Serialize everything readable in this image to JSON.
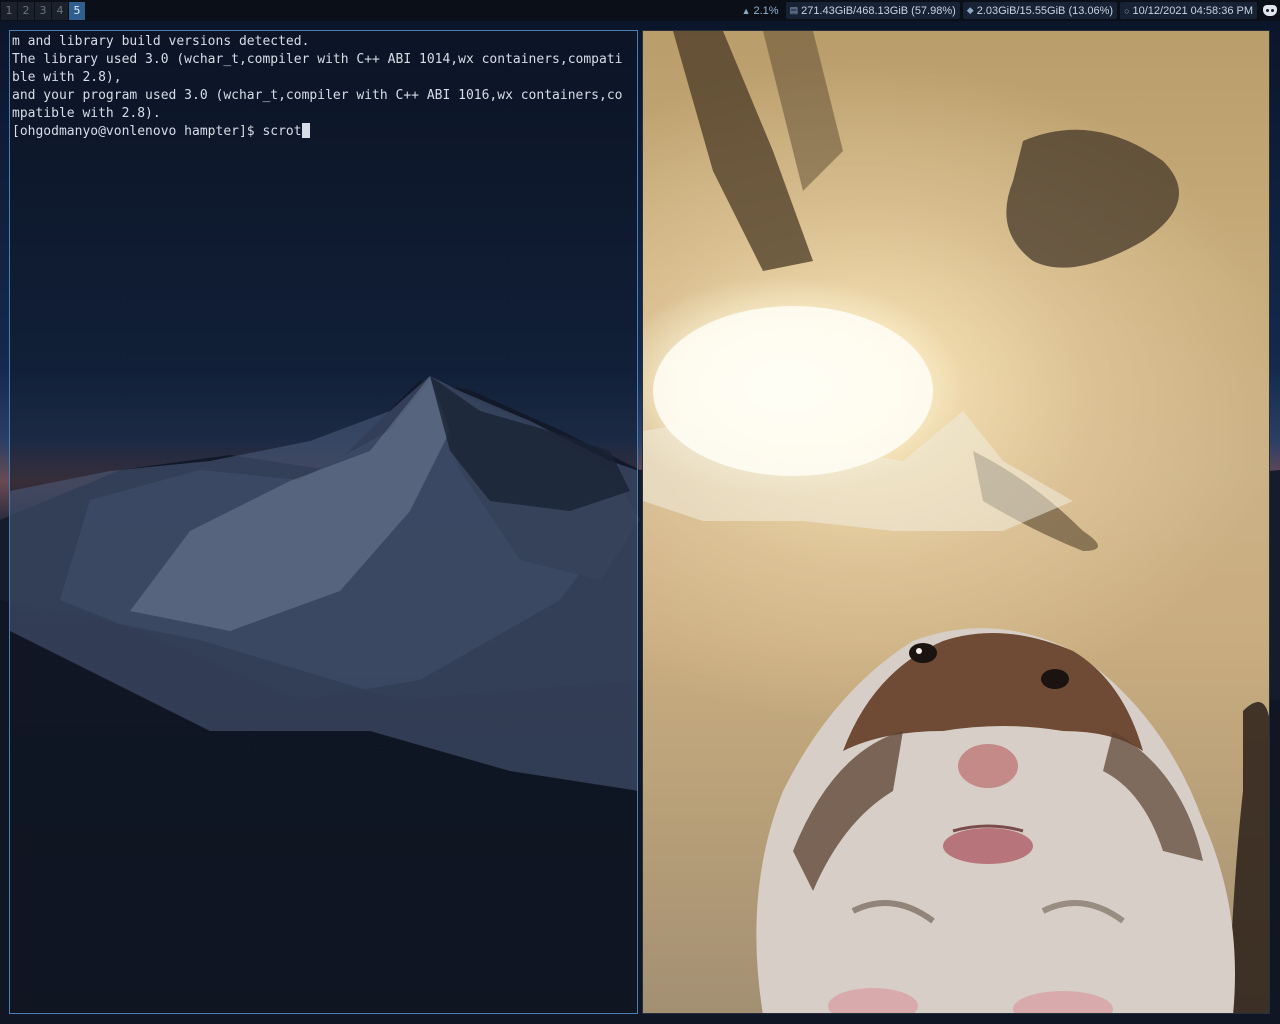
{
  "topbar": {
    "workspaces": [
      {
        "label": "1",
        "active": false
      },
      {
        "label": "2",
        "active": false
      },
      {
        "label": "3",
        "active": false
      },
      {
        "label": "4",
        "active": false
      },
      {
        "label": "5",
        "active": true
      }
    ],
    "status": {
      "cpu": "2.1%",
      "disk": "271.43GiB/468.13GiB (57.98%)",
      "memory": "2.03GiB/15.55GiB (13.06%)",
      "datetime": "10/12/2021 04:58:36 PM"
    },
    "tray_icon": "discord-icon"
  },
  "terminal": {
    "lines": [
      "m and library build versions detected.",
      "The library used 3.0 (wchar_t,compiler with C++ ABI 1014,wx containers,compati",
      "ble with 2.8),",
      "and your program used 3.0 (wchar_t,compiler with C++ ABI 1016,wx containers,co",
      "mpatible with 2.8)."
    ],
    "prompt": "[ohgodmanyo@vonlenovo hampter]$ ",
    "command": "scrot"
  },
  "viewer": {
    "image_subject": "hamster-photo"
  },
  "colors": {
    "accent_border": "#4a7fb5",
    "active_workspace": "#2f5f8f",
    "terminal_text": "#d6dde6"
  }
}
